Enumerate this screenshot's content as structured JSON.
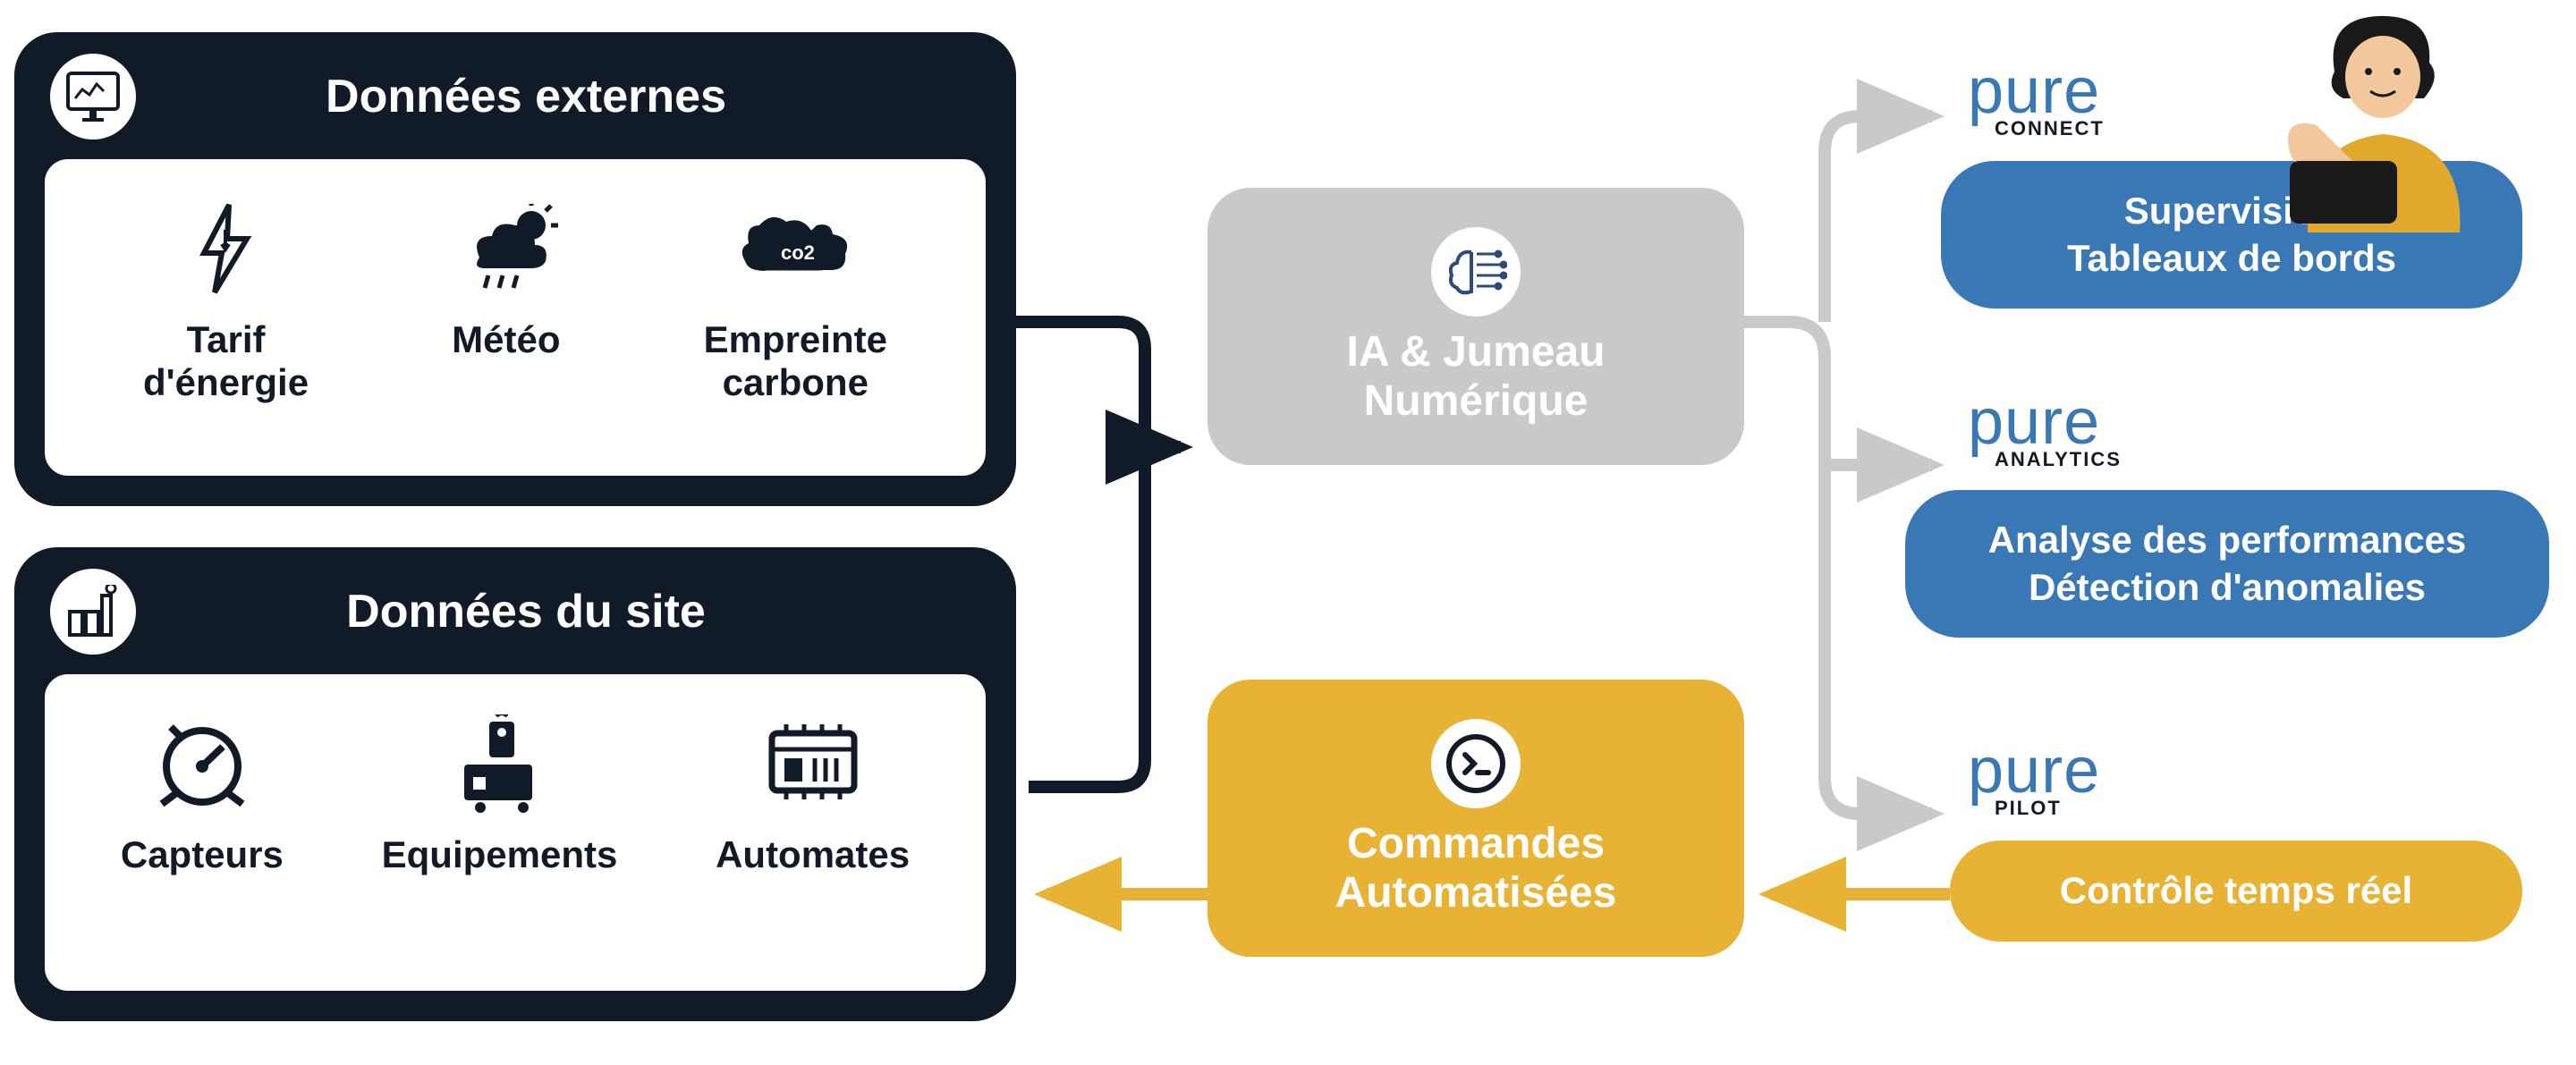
{
  "externes": {
    "title": "Données externes",
    "items": [
      {
        "label": "Tarif\nd'énergie"
      },
      {
        "label": "Météo"
      },
      {
        "label": "Empreinte\ncarbone"
      }
    ]
  },
  "site": {
    "title": "Données du site",
    "items": [
      {
        "label": "Capteurs"
      },
      {
        "label": "Equipements"
      },
      {
        "label": "Automates"
      }
    ]
  },
  "middle": {
    "ai": "IA & Jumeau\nNumérique",
    "cmd": "Commandes\nAutomatisées"
  },
  "products": [
    {
      "brand": "pure",
      "sub": "CONNECT",
      "desc1": "Supervision",
      "desc2": "Tableaux de bords"
    },
    {
      "brand": "pure",
      "sub": "ANALYTICS",
      "desc1": "Analyse des performances",
      "desc2": "Détection d'anomalies"
    },
    {
      "brand": "pure",
      "sub": "PILOT",
      "desc1": "Contrôle temps réel",
      "desc2": ""
    }
  ]
}
